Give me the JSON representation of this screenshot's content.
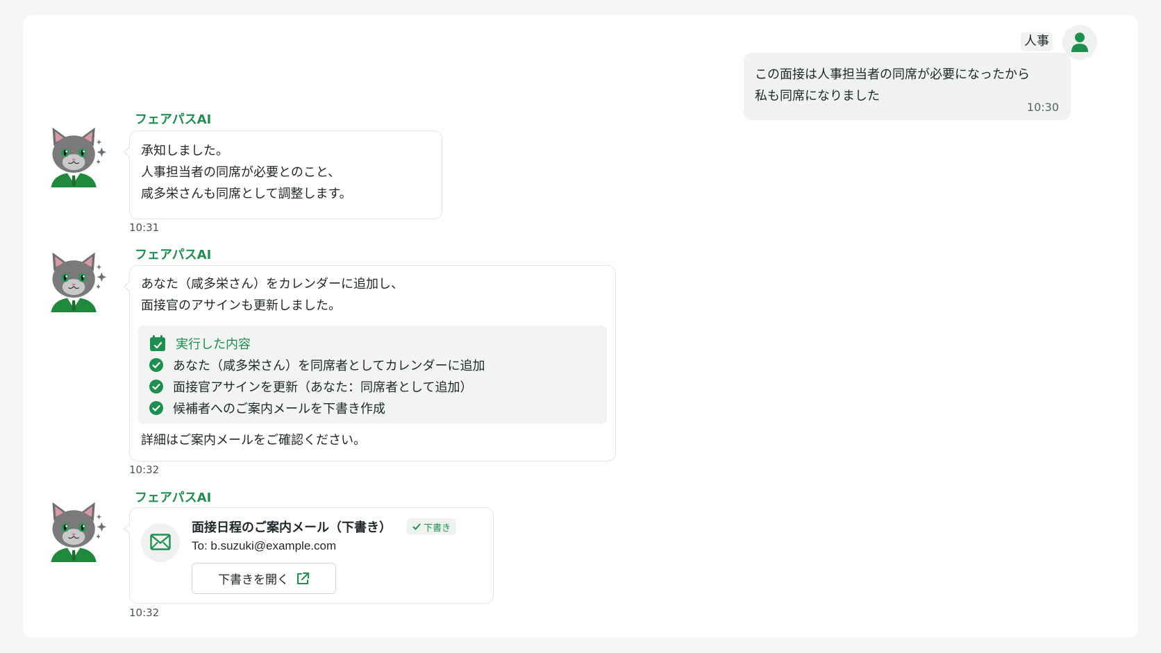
{
  "colors": {
    "accent": "#1e8f4e",
    "bubble_user": "#eff2f1",
    "panel": "#ffffff"
  },
  "user_message": {
    "sender": "人事",
    "lines": [
      "この面接は人事担当者の同席が必要になったから",
      "私も同席になりました"
    ],
    "time": "10:30"
  },
  "ai_messages": [
    {
      "sender": "フェアパスAI",
      "lines": [
        "承知しました。",
        "人事担当者の同席が必要とのこと、",
        "咸多栄さんも同席として調整します。"
      ],
      "time": "10:31"
    },
    {
      "sender": "フェアパスAI",
      "lines": [
        "あなた（咸多栄さん）をカレンダーに追加し、",
        "面接官のアサインも更新しました。"
      ],
      "actions_title": "実行した内容",
      "actions": [
        "あなた（咸多栄さん）を同席者としてカレンダーに追加",
        "面接官アサインを更新（あなた：同席者として追加）",
        "候補者へのご案内メールを下書き作成"
      ],
      "footer": "詳細はご案内メールをご確認ください。",
      "time": "10:32"
    },
    {
      "sender": "フェアパスAI",
      "mail_title": "面接日程のご案内メール（下書き）",
      "badge": "下書き",
      "to": "To: b.suzuki@example.com",
      "button": "下書きを開く",
      "time": "10:32"
    }
  ],
  "icons": {
    "user_avatar": "person-icon",
    "ai_avatar": "cat-avatar-icon",
    "calendar": "calendar-icon",
    "check": "check-circle-icon",
    "mail": "mail-icon",
    "external": "external-link-icon"
  }
}
